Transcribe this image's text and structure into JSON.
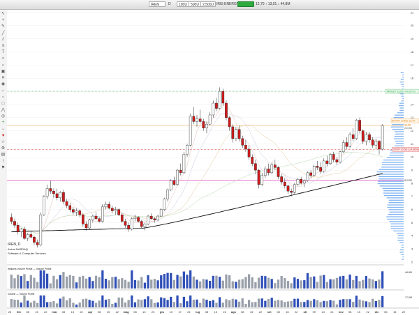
{
  "toolbar": {
    "symbol": "IREN",
    "period": "D",
    "field1": "100U",
    "field2": "500U",
    "field3": "2.500U",
    "company": "IRIS ENERGY LTD.",
    "change_badge": "",
    "quote": "12,70 ↑ 13,01 ↓ 44,8M"
  },
  "left_tools": [
    "arrow-icon",
    "crosshair-icon",
    "pencil-icon",
    "line-icon",
    "channel-icon",
    "fib-icon",
    "text-icon",
    "zoom-icon",
    "magnet-icon",
    "lock-icon",
    "trash-icon",
    "eye-icon",
    "measure-icon",
    "brush-icon",
    "shape-icon",
    "pattern-icon",
    "target-icon",
    "plus-icon",
    "minus-icon",
    "heart-icon",
    "star-icon",
    "gear-icon",
    "layers-icon",
    "alert-icon",
    "flag-icon"
  ],
  "info": {
    "ticker_line": "IREN, D",
    "exchange": "Azioni NASDAQ",
    "sector": "Software & Computer Services",
    "indicator1": "Williams Volume Profile — Volume Profile",
    "indicator2": "Volume — Volume Profile"
  },
  "tags": {
    "target": "TARGET 15,00 (+20,67%)",
    "entry": "ENTRY LONG 12,40",
    "price": "12,40",
    "price_sub": "213,54",
    "stop": "STOP 10,58 (-14,68%)",
    "hline": "8,2152",
    "vol1": "46,8M",
    "vol2": "17,5M"
  },
  "colors": {
    "up": "#ffffff",
    "down": "#d11a1a",
    "sma200": "#111111",
    "pink_line": "#e040c0",
    "target": "#2fae4a",
    "stop": "#d11a1a",
    "entry": "#e78a1c",
    "volume_up": "#3050b8",
    "volume_down": "#9aa0aa",
    "profile": "#6aa6f0"
  },
  "chart_data": {
    "type": "candlestick",
    "price_axis_ticks": [
      "21",
      "20",
      "19",
      "18",
      "17",
      "16",
      "15",
      "14",
      "13",
      "12",
      "11",
      "10",
      "9",
      "8",
      "7",
      "6",
      "5",
      "4",
      "3",
      "2"
    ],
    "ylim": [
      2,
      21
    ],
    "x_axis_labels": [
      "26",
      "feb",
      "08",
      "15",
      "22",
      "mar",
      "08",
      "15",
      "22",
      "apr",
      "08",
      "15",
      "22",
      "mag",
      "08",
      "13",
      "20",
      "giu",
      "10",
      "17",
      "24",
      "lug",
      "08",
      "15",
      "22",
      "ago",
      "08",
      "15",
      "22",
      "set",
      "08",
      "16",
      "22",
      "ott",
      "09",
      "14",
      "21",
      "nov",
      "08",
      "15",
      "22",
      "dic",
      "06",
      "15",
      "22"
    ],
    "target_level": 15.0,
    "entry_level": 12.4,
    "stop_level": 10.58,
    "horizontal_line": 8.2152,
    "candles": [
      [
        5.4,
        5.7,
        4.9,
        5.1
      ],
      [
        5.1,
        5.3,
        4.6,
        4.8
      ],
      [
        4.8,
        5.0,
        4.1,
        4.3
      ],
      [
        4.3,
        4.6,
        3.9,
        4.5
      ],
      [
        4.5,
        4.7,
        3.7,
        3.8
      ],
      [
        3.8,
        4.2,
        3.6,
        4.1
      ],
      [
        4.1,
        4.4,
        3.8,
        3.9
      ],
      [
        3.9,
        4.0,
        3.3,
        3.5
      ],
      [
        3.5,
        3.7,
        3.1,
        3.3
      ],
      [
        3.3,
        5.8,
        3.2,
        5.6
      ],
      [
        5.6,
        7.1,
        5.5,
        7.0
      ],
      [
        7.0,
        7.9,
        6.8,
        7.6
      ],
      [
        7.6,
        8.2,
        7.2,
        7.4
      ],
      [
        7.4,
        7.6,
        6.9,
        7.2
      ],
      [
        7.2,
        7.6,
        6.7,
        6.9
      ],
      [
        6.9,
        7.4,
        6.6,
        7.3
      ],
      [
        7.3,
        7.5,
        6.4,
        6.6
      ],
      [
        6.6,
        6.8,
        6.1,
        6.3
      ],
      [
        6.3,
        6.5,
        5.8,
        6.0
      ],
      [
        6.0,
        6.2,
        5.6,
        5.8
      ],
      [
        5.8,
        6.1,
        5.5,
        5.9
      ],
      [
        5.9,
        6.0,
        5.4,
        5.6
      ],
      [
        5.6,
        5.7,
        4.7,
        4.9
      ],
      [
        4.9,
        5.1,
        4.4,
        4.6
      ],
      [
        4.6,
        5.3,
        4.5,
        5.2
      ],
      [
        5.2,
        5.6,
        5.0,
        5.5
      ],
      [
        5.5,
        5.8,
        5.2,
        5.3
      ],
      [
        5.3,
        5.4,
        5.0,
        5.1
      ],
      [
        5.1,
        6.4,
        5.0,
        6.2
      ],
      [
        6.2,
        6.6,
        6.0,
        6.4
      ],
      [
        6.4,
        6.6,
        6.0,
        6.1
      ],
      [
        6.1,
        6.3,
        5.7,
        5.9
      ],
      [
        5.9,
        6.2,
        5.6,
        6.0
      ],
      [
        6.0,
        6.1,
        5.5,
        5.6
      ],
      [
        5.6,
        5.7,
        5.0,
        5.1
      ],
      [
        5.1,
        5.3,
        4.6,
        4.8
      ],
      [
        4.8,
        5.0,
        4.3,
        4.5
      ],
      [
        4.5,
        5.4,
        4.4,
        5.3
      ],
      [
        5.3,
        5.6,
        5.1,
        5.4
      ],
      [
        5.4,
        5.5,
        5.0,
        5.1
      ],
      [
        5.1,
        5.2,
        4.6,
        4.7
      ],
      [
        4.7,
        5.0,
        4.4,
        4.9
      ],
      [
        4.9,
        5.6,
        4.8,
        5.5
      ],
      [
        5.5,
        5.7,
        5.2,
        5.3
      ],
      [
        5.3,
        5.4,
        5.0,
        5.2
      ],
      [
        5.2,
        5.6,
        5.1,
        5.5
      ],
      [
        5.5,
        6.1,
        5.4,
        6.0
      ],
      [
        6.0,
        6.9,
        5.9,
        6.8
      ],
      [
        6.8,
        7.6,
        6.6,
        7.5
      ],
      [
        7.5,
        8.3,
        7.4,
        8.2
      ],
      [
        8.2,
        8.5,
        7.8,
        7.9
      ],
      [
        7.9,
        9.1,
        7.8,
        9.0
      ],
      [
        9.0,
        9.5,
        8.6,
        8.8
      ],
      [
        8.8,
        10.4,
        8.7,
        10.2
      ],
      [
        10.2,
        11.0,
        10.0,
        10.9
      ],
      [
        10.9,
        13.3,
        10.8,
        13.1
      ],
      [
        13.1,
        13.8,
        12.5,
        12.7
      ],
      [
        12.7,
        13.2,
        12.3,
        12.9
      ],
      [
        12.9,
        13.6,
        12.6,
        12.7
      ],
      [
        12.7,
        12.9,
        12.0,
        12.2
      ],
      [
        12.2,
        12.7,
        11.8,
        12.5
      ],
      [
        12.5,
        13.4,
        12.4,
        13.2
      ],
      [
        13.2,
        14.3,
        13.0,
        14.1
      ],
      [
        14.1,
        14.5,
        13.5,
        13.7
      ],
      [
        13.7,
        15.3,
        13.6,
        15.0
      ],
      [
        15.0,
        15.2,
        13.9,
        14.1
      ],
      [
        14.1,
        14.3,
        12.8,
        13.0
      ],
      [
        13.0,
        13.1,
        12.0,
        12.3
      ],
      [
        12.3,
        12.5,
        11.1,
        11.4
      ],
      [
        11.4,
        12.3,
        11.2,
        12.1
      ],
      [
        12.1,
        12.4,
        11.2,
        11.4
      ],
      [
        11.4,
        11.6,
        10.7,
        10.9
      ],
      [
        10.9,
        11.3,
        10.4,
        10.6
      ],
      [
        10.6,
        10.9,
        9.8,
        10.0
      ],
      [
        10.0,
        10.2,
        9.3,
        9.5
      ],
      [
        9.5,
        9.8,
        8.7,
        9.0
      ],
      [
        9.0,
        9.1,
        7.6,
        7.9
      ],
      [
        7.9,
        8.8,
        7.8,
        8.6
      ],
      [
        8.6,
        9.3,
        8.4,
        9.1
      ],
      [
        9.1,
        9.5,
        8.6,
        8.8
      ],
      [
        8.8,
        9.6,
        8.7,
        9.4
      ],
      [
        9.4,
        9.8,
        9.0,
        9.2
      ],
      [
        9.2,
        9.3,
        8.3,
        8.5
      ],
      [
        8.5,
        8.7,
        7.9,
        8.1
      ],
      [
        8.1,
        8.4,
        7.6,
        7.8
      ],
      [
        7.8,
        7.9,
        7.2,
        7.4
      ],
      [
        7.4,
        7.6,
        7.0,
        7.3
      ],
      [
        7.3,
        8.0,
        7.2,
        7.9
      ],
      [
        7.9,
        8.4,
        7.8,
        8.3
      ],
      [
        8.3,
        8.5,
        7.9,
        8.0
      ],
      [
        8.0,
        8.3,
        7.7,
        8.2
      ],
      [
        8.2,
        8.9,
        8.1,
        8.8
      ],
      [
        8.8,
        9.0,
        8.4,
        8.6
      ],
      [
        8.6,
        9.4,
        8.5,
        9.3
      ],
      [
        9.3,
        9.7,
        9.0,
        9.2
      ],
      [
        9.2,
        9.6,
        8.7,
        8.9
      ],
      [
        8.9,
        9.9,
        8.8,
        9.7
      ],
      [
        9.7,
        10.1,
        9.3,
        9.5
      ],
      [
        9.5,
        10.3,
        9.4,
        10.2
      ],
      [
        10.2,
        10.4,
        9.6,
        9.8
      ],
      [
        9.8,
        10.0,
        9.4,
        9.6
      ],
      [
        9.6,
        10.5,
        9.5,
        10.4
      ],
      [
        10.4,
        11.3,
        10.3,
        11.1
      ],
      [
        11.1,
        11.5,
        10.6,
        10.8
      ],
      [
        10.8,
        11.9,
        10.7,
        11.7
      ],
      [
        11.7,
        12.2,
        11.2,
        11.4
      ],
      [
        11.4,
        12.9,
        11.3,
        12.8
      ],
      [
        12.8,
        13.0,
        11.8,
        12.0
      ],
      [
        12.0,
        12.1,
        11.0,
        11.2
      ],
      [
        11.2,
        11.9,
        10.9,
        11.7
      ],
      [
        11.7,
        11.9,
        11.1,
        11.3
      ],
      [
        11.3,
        11.5,
        10.7,
        10.9
      ],
      [
        10.9,
        11.4,
        10.6,
        11.2
      ],
      [
        11.2,
        11.3,
        10.2,
        10.6
      ],
      [
        10.6,
        12.5,
        10.5,
        12.4
      ]
    ]
  }
}
